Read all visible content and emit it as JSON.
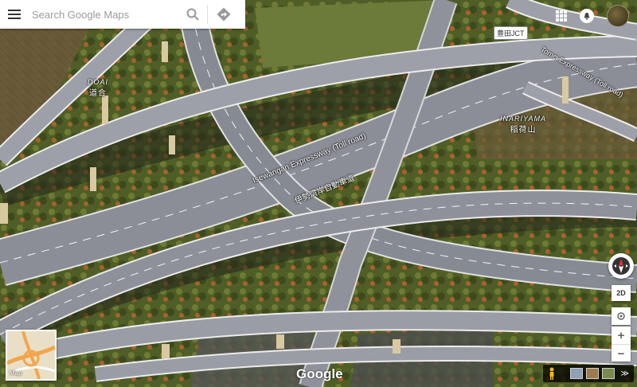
{
  "search": {
    "placeholder": "Search Google Maps"
  },
  "icons": {
    "menu": "menu-icon",
    "search": "search-icon",
    "directions": "directions-icon",
    "apps": "apps-icon",
    "notifications": "notifications-icon",
    "compass": "compass-icon",
    "location": "my-location-icon",
    "pegman": "pegman-icon"
  },
  "map": {
    "places": [
      {
        "romaji": "DOAI",
        "kanji": "道合"
      },
      {
        "romaji": "INARIYAMA",
        "kanji": "稲荷山"
      }
    ],
    "junction": "豊田JCT",
    "roads": [
      {
        "text": "Isewangan Expressway (Toll road)"
      },
      {
        "text": "伊勢湾岸自動車道"
      },
      {
        "text": "Tomei Expressway (Toll road)"
      }
    ]
  },
  "controls": {
    "view_toggle": "2D",
    "zoom_in": "+",
    "zoom_out": "−",
    "expand": "≫"
  },
  "minimap": {
    "label": "Map"
  },
  "logo": {
    "text": "Google"
  },
  "colors": {
    "road_surface": "#8d9099",
    "road_edge": "#e8e8e8",
    "vegetation": "#5a6a2a",
    "autumn": "#b8622a",
    "ground": "#6b5a3a"
  }
}
